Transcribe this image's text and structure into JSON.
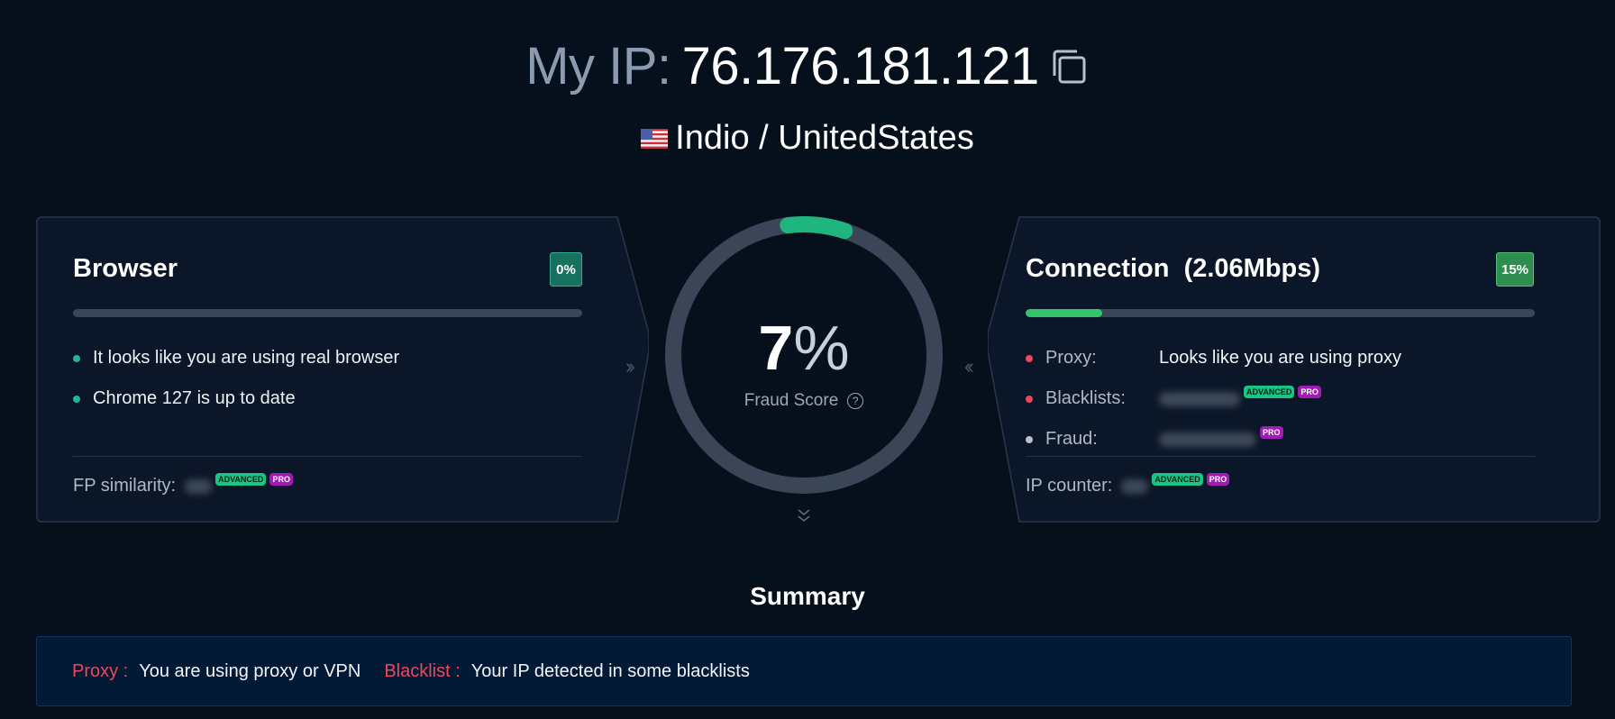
{
  "header": {
    "ip_label": "My IP:",
    "ip_value": "76.176.181.121",
    "copy_icon": "copy-icon",
    "flag_icon": "us-flag-icon",
    "location": "Indio / UnitedStates"
  },
  "browser_card": {
    "title": "Browser",
    "percent": "0%",
    "progress": 0,
    "items": [
      {
        "text": "It looks like you are using real browser",
        "status": "teal"
      },
      {
        "text": "Chrome 127 is up to date",
        "status": "teal"
      }
    ],
    "footer_label": "FP similarity:",
    "tag_advanced": "ADVANCED",
    "tag_pro": "PRO"
  },
  "gauge": {
    "value": "7",
    "percent_sign": "%",
    "label": "Fraud Score",
    "help_icon": "?",
    "fraction": 0.07
  },
  "connection_card": {
    "title": "Connection",
    "speed": "(2.06Mbps)",
    "percent": "15%",
    "progress": 0.15,
    "items": [
      {
        "key": "Proxy:",
        "value": "Looks like you are using proxy",
        "status": "red"
      },
      {
        "key": "Blacklists:",
        "value": "",
        "status": "red",
        "tags": [
          "ADVANCED",
          "PRO"
        ]
      },
      {
        "key": "Fraud:",
        "value": "",
        "status": "gray",
        "tags": [
          "PRO"
        ]
      }
    ],
    "footer_label": "IP counter:",
    "tag_advanced": "ADVANCED",
    "tag_pro": "PRO"
  },
  "summary": {
    "title": "Summary",
    "entries": [
      {
        "key": "Proxy :",
        "value": "You are using proxy or VPN"
      },
      {
        "key": "Blacklist :",
        "value": "Your IP detected in some blacklists"
      }
    ]
  },
  "colors": {
    "background": "#06101c",
    "card": "#0b1628",
    "gauge_track": "#3a4658",
    "gauge_fill": "#1fb57f",
    "accent_red": "#f0465a"
  }
}
